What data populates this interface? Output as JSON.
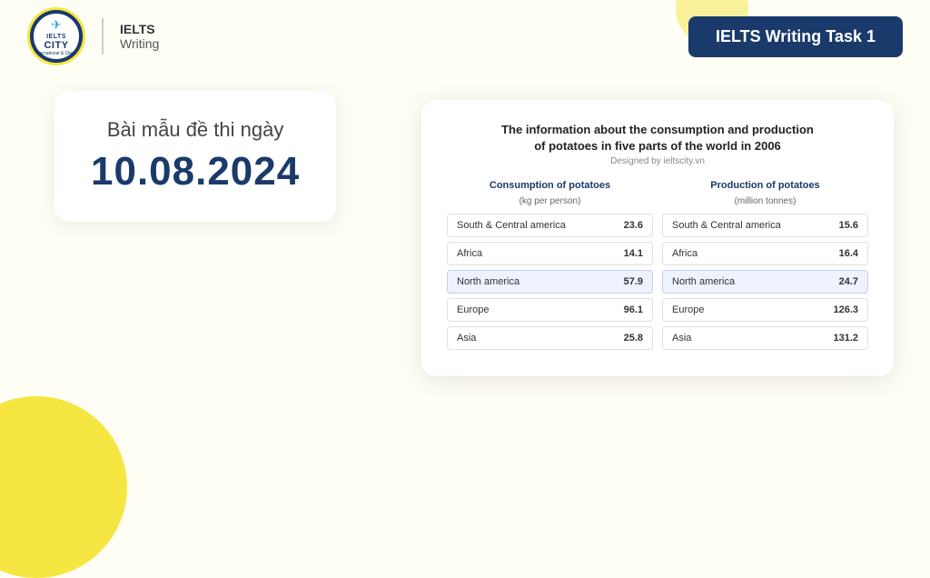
{
  "background": {
    "color": "#fffef5"
  },
  "header": {
    "logo_top": "IELTS",
    "logo_city": "CITY",
    "logo_sub": "International & Clever",
    "title_line1": "IELTS",
    "title_line2": "Writing",
    "badge_label": "IELTS Writing Task 1"
  },
  "left": {
    "date_label": "Bài mẫu đề thi ngày",
    "date_value": "10.08.2024"
  },
  "table": {
    "title_line1": "The information about the consumption and production",
    "title_line2": "of potatoes in five parts of the world in 2006",
    "designed_by": "Designed by ieltscity.vn",
    "consumption_header": "Consumption of potatoes",
    "consumption_unit": "(kg per person)",
    "production_header": "Production of potatoes",
    "production_unit": "(million tonnes)",
    "rows": [
      {
        "region": "South & Central america",
        "consumption": "23.6",
        "production": "15.6",
        "highlighted": false
      },
      {
        "region": "Africa",
        "consumption": "14.1",
        "production": "16.4",
        "highlighted": false
      },
      {
        "region": "North america",
        "consumption": "57.9",
        "production": "24.7",
        "highlighted": true
      },
      {
        "region": "Europe",
        "consumption": "96.1",
        "production": "126.3",
        "highlighted": false
      },
      {
        "region": "Asia",
        "consumption": "25.8",
        "production": "131.2",
        "highlighted": false
      }
    ]
  }
}
